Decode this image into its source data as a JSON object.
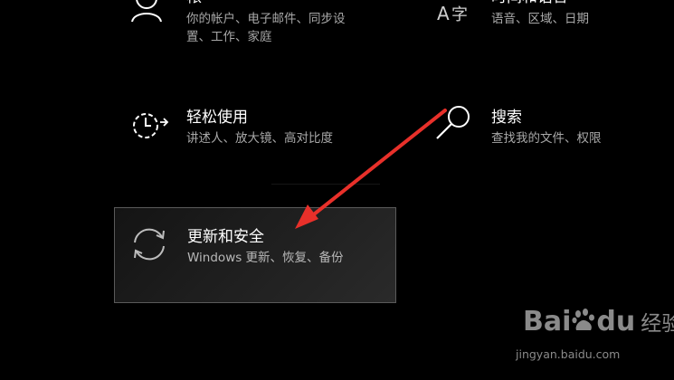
{
  "tiles": {
    "accounts": {
      "title": "帐",
      "desc_line1": "你的帐户、电子邮件、同步设",
      "desc_line2": "置、工作、家庭",
      "icon": "person-icon"
    },
    "time_language": {
      "title": "时间和语言",
      "desc_line1": "语音、区域、日期",
      "icon": "time-language-icon"
    },
    "ease_of_access": {
      "title": "轻松使用",
      "desc": "讲述人、放大镜、高对比度",
      "icon": "ease-of-access-timer-icon"
    },
    "search": {
      "title": "搜索",
      "desc": "查找我的文件、权限",
      "icon": "search-icon"
    },
    "update_security": {
      "title": "更新和安全",
      "desc": "Windows 更新、恢复、备份",
      "icon": "sync-icon"
    }
  },
  "annotation": {
    "arrow_color": "#e8302a",
    "icon": "red-arrow-icon"
  },
  "watermark": {
    "logo_text_left": "Bai",
    "logo_text_right": "du",
    "logo_suffix": "经验",
    "url": "jingyan.baidu.com"
  }
}
